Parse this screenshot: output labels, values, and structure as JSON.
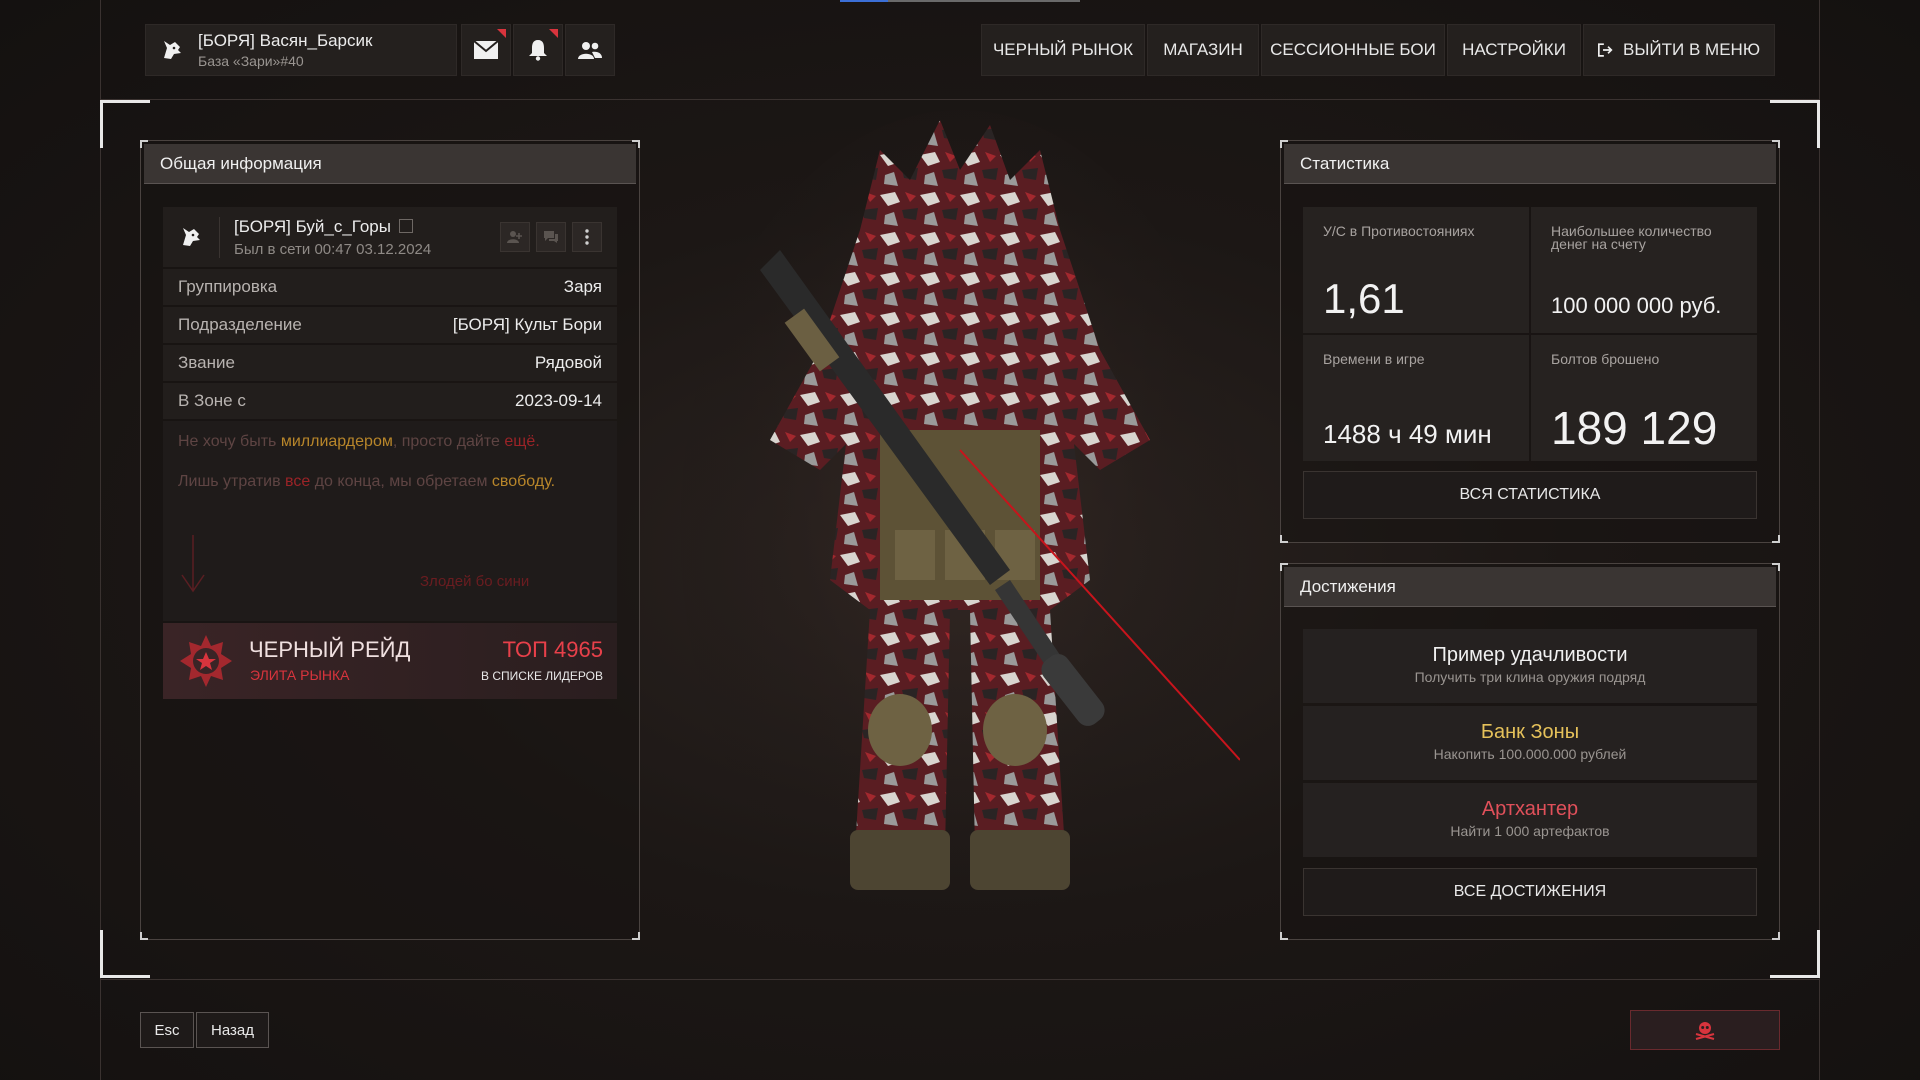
{
  "header": {
    "user_name": "[БОРЯ] Васян_Барсик",
    "user_base": "База «Зари»#40",
    "nav": {
      "black_market": "ЧЕРНЫЙ РЫНОК",
      "shop": "МАГАЗИН",
      "session_battles": "СЕССИОННЫЕ БОИ",
      "settings": "НАСТРОЙКИ",
      "exit_menu": "ВЫЙТИ В МЕНЮ"
    }
  },
  "general": {
    "title": "Общая информация",
    "player_name": "[БОРЯ] Буй_с_Горы",
    "last_seen": "Был в сети 00:47 03.12.2024",
    "rows": [
      {
        "key": "Группировка",
        "value": "Заря"
      },
      {
        "key": "Подразделение",
        "value": "[БОРЯ] Культ Бори"
      },
      {
        "key": "Звание",
        "value": "Рядовой"
      },
      {
        "key": "В Зоне с",
        "value": "2023-09-14"
      }
    ],
    "bio": {
      "line1_a": "Не хочу быть ",
      "line1_b": "миллиардером",
      "line1_c": ", просто дайте ",
      "line1_d": "ещё.",
      "line2_a": "Лишь утратив ",
      "line2_b": "все",
      "line2_c": " до конца, мы обретаем ",
      "line2_d": "свободу.",
      "signature": "Злодей бо сини"
    },
    "raid": {
      "title": "ЧЕРНЫЙ РЕЙД",
      "subtitle": "ЭЛИТА РЫНКА",
      "top": "ТОП 4965",
      "top_sub": "В СПИСКЕ ЛИДЕРОВ"
    }
  },
  "stats": {
    "title": "Статистика",
    "kd_label": "У/С в Противостояниях",
    "kd_value": "1,61",
    "money_label_1": "Наибольшее количество",
    "money_label_2": "денег на счету",
    "money_value": "100 000 000 руб.",
    "time_label": "Времени в игре",
    "time_value": "1488 ч 49 мин",
    "bolts_label": "Болтов брошено",
    "bolts_value": "189 129",
    "all_button": "ВСЯ СТАТИСТИКА"
  },
  "achievements": {
    "title": "Достижения",
    "items": [
      {
        "title": "Пример удачливости",
        "desc": "Получить три клина оружия подряд",
        "color": "#f0f0f0"
      },
      {
        "title": "Банк Зоны",
        "desc": "Накопить 100.000.000 рублей",
        "color": "#e5c15a"
      },
      {
        "title": "Артхантер",
        "desc": "Найти 1 000 артефактов",
        "color": "#e0505a"
      }
    ],
    "all_button": "ВСЕ ДОСТИЖЕНИЯ"
  },
  "footer": {
    "esc_key": "Esc",
    "back_label": "Назад"
  },
  "colors": {
    "accent_red": "#d8343d",
    "gold": "#e5c15a"
  }
}
